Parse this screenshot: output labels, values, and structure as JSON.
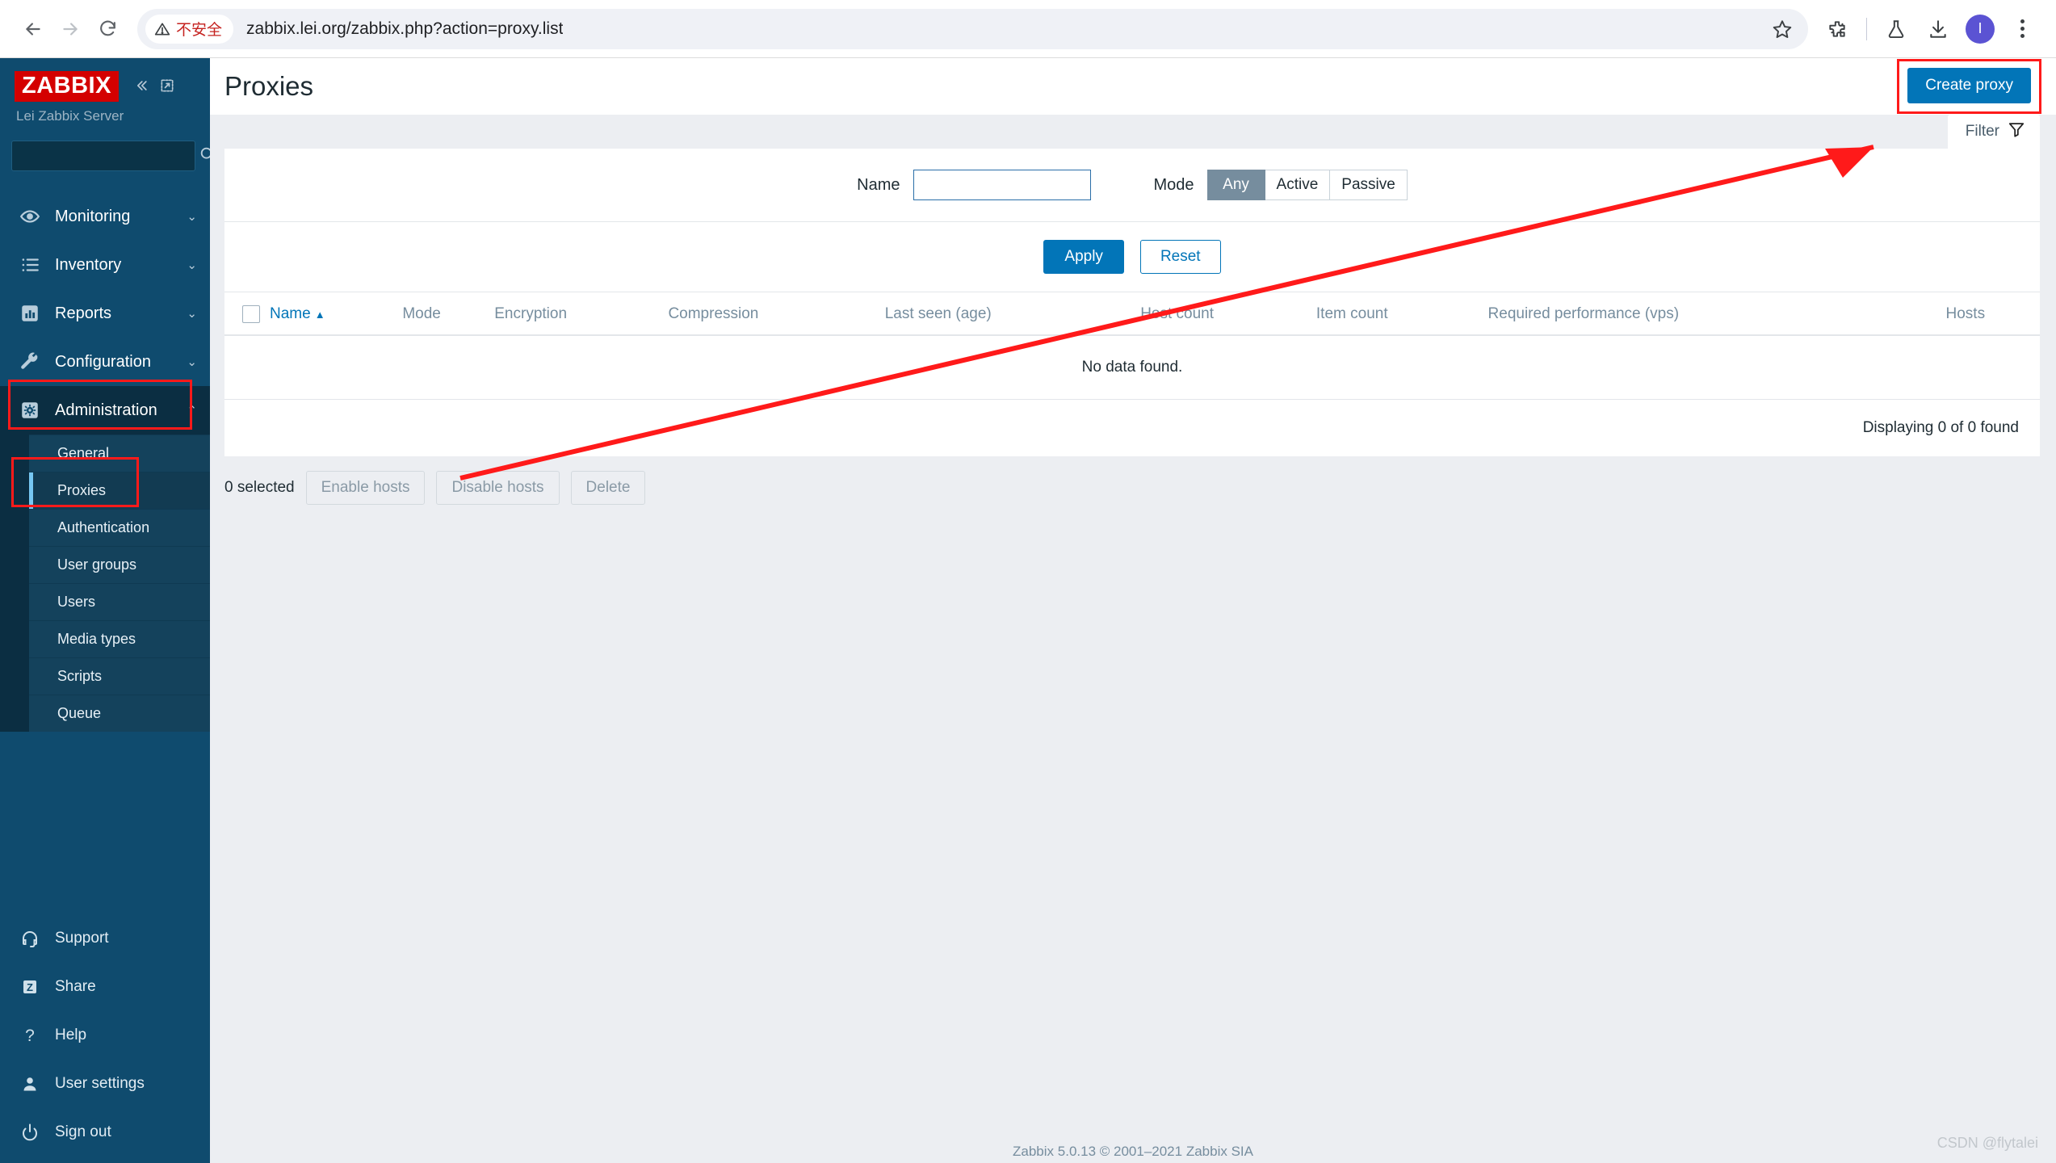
{
  "browser": {
    "back_icon": "arrow-left-icon",
    "forward_icon": "arrow-right-icon",
    "reload_icon": "reload-icon",
    "security_warning": "不安全",
    "security_icon": "warning-triangle-icon",
    "url": "zabbix.lei.org/zabbix.php?action=proxy.list",
    "bookmark_icon": "star-icon",
    "extensions_icon": "puzzle-icon",
    "labs_icon": "flask-icon",
    "downloads_icon": "download-icon",
    "profile_initial": "I",
    "menu_icon": "kebab-menu-icon"
  },
  "sidebar": {
    "logo_text": "ZABBIX",
    "server_name": "Lei Zabbix Server",
    "collapse_icon": "double-chevron-left-icon",
    "compact_icon": "collapse-panel-icon",
    "search_placeholder": "",
    "search_value": "",
    "search_icon": "search-icon",
    "nav": [
      {
        "label": "Monitoring",
        "icon": "eye-icon",
        "chevron": "⌄",
        "active": false
      },
      {
        "label": "Inventory",
        "icon": "list-icon",
        "chevron": "⌄",
        "active": false
      },
      {
        "label": "Reports",
        "icon": "bar-chart-icon",
        "chevron": "⌄",
        "active": false
      },
      {
        "label": "Configuration",
        "icon": "wrench-icon",
        "chevron": "⌄",
        "active": false
      },
      {
        "label": "Administration",
        "icon": "gear-icon",
        "chevron": "⌃",
        "active": true
      }
    ],
    "submenu": [
      {
        "label": "General",
        "selected": false
      },
      {
        "label": "Proxies",
        "selected": true
      },
      {
        "label": "Authentication",
        "selected": false
      },
      {
        "label": "User groups",
        "selected": false
      },
      {
        "label": "Users",
        "selected": false
      },
      {
        "label": "Media types",
        "selected": false
      },
      {
        "label": "Scripts",
        "selected": false
      },
      {
        "label": "Queue",
        "selected": false
      }
    ],
    "footer": [
      {
        "label": "Support",
        "icon": "headset-icon"
      },
      {
        "label": "Share",
        "icon": "zabbix-share-icon"
      },
      {
        "label": "Help",
        "icon": "question-mark-icon"
      },
      {
        "label": "User settings",
        "icon": "user-icon"
      },
      {
        "label": "Sign out",
        "icon": "power-icon"
      }
    ]
  },
  "header": {
    "title": "Proxies",
    "create_button": "Create proxy"
  },
  "filter": {
    "tab_label": "Filter",
    "tab_icon": "funnel-icon",
    "name_label": "Name",
    "name_value": "",
    "name_placeholder": "",
    "mode_label": "Mode",
    "mode_options": [
      {
        "label": "Any",
        "selected": true
      },
      {
        "label": "Active",
        "selected": false
      },
      {
        "label": "Passive",
        "selected": false
      }
    ],
    "apply_label": "Apply",
    "reset_label": "Reset"
  },
  "table": {
    "select_all_icon": "checkbox-unchecked-icon",
    "columns": [
      {
        "label": "Name",
        "sortable": true,
        "sort_arrow": "▲"
      },
      {
        "label": "Mode",
        "sortable": false,
        "sort_arrow": ""
      },
      {
        "label": "Encryption",
        "sortable": false,
        "sort_arrow": ""
      },
      {
        "label": "Compression",
        "sortable": false,
        "sort_arrow": ""
      },
      {
        "label": "Last seen (age)",
        "sortable": false,
        "sort_arrow": ""
      },
      {
        "label": "Host count",
        "sortable": false,
        "sort_arrow": ""
      },
      {
        "label": "Item count",
        "sortable": false,
        "sort_arrow": ""
      },
      {
        "label": "Required performance (vps)",
        "sortable": false,
        "sort_arrow": ""
      },
      {
        "label": "Hosts",
        "sortable": false,
        "sort_arrow": ""
      }
    ],
    "empty_message": "No data found.",
    "displaying": "Displaying 0 of 0 found"
  },
  "actions": {
    "selected_count": "0 selected",
    "enable_hosts": "Enable hosts",
    "disable_hosts": "Disable hosts",
    "delete": "Delete"
  },
  "footer": {
    "copyright": "Zabbix 5.0.13 © 2001–2021 Zabbix SIA",
    "watermark": "CSDN @flytalei"
  },
  "colors": {
    "sidebar_bg": "#0f4b6e",
    "sidebar_active": "#0b2e42",
    "brand_red": "#d40000",
    "accent_blue": "#0275b8",
    "annotation_red": "#ff1a1a",
    "selected_bar": "#76c7f2"
  }
}
